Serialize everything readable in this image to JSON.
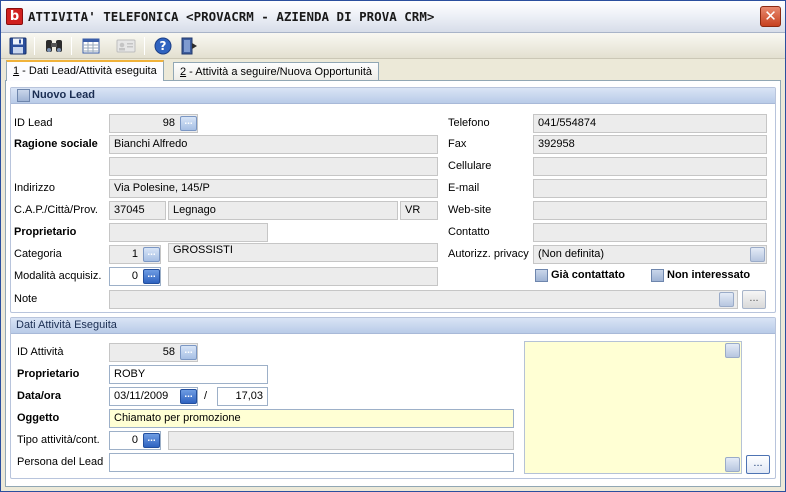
{
  "window": {
    "title": "ATTIVITA' TELEFONICA <PROVACRM - AZIENDA DI PROVA CRM>",
    "app_letter": "b",
    "close_glyph": "✕"
  },
  "toolbar": {
    "icons": [
      "save-icon",
      "binoculars-icon",
      "grid-icon",
      "contact-card-icon",
      "help-icon",
      "exit-door-icon"
    ]
  },
  "tabs": [
    {
      "num": "1",
      "label": " - Dati Lead/Attività eseguita",
      "active": true
    },
    {
      "num": "2",
      "label": " - Attività a seguire/Nuova Opportunità",
      "active": false
    }
  ],
  "lead": {
    "header": "Nuovo Lead",
    "id_label": "ID Lead",
    "id_value": "98",
    "ragione_label": "Ragione sociale",
    "ragione_value": "Bianchi Alfredo",
    "ragione_value2": "",
    "indirizzo_label": "Indirizzo",
    "indirizzo_value": "Via Polesine, 145/P",
    "cap_label": "C.A.P./Città/Prov.",
    "cap_value": "37045",
    "citta_value": "Legnago",
    "prov_value": "VR",
    "proprietario_label": "Proprietario",
    "proprietario_value": "",
    "categoria_label": "Categoria",
    "categoria_code": "1",
    "categoria_value": "GROSSISTI",
    "modalita_label": "Modalità acquisiz.",
    "modalita_code": "0",
    "modalita_value": "",
    "note_label": "Note",
    "note_value": "",
    "telefono_label": "Telefono",
    "telefono_value": "041/554874",
    "fax_label": "Fax",
    "fax_value": "392958",
    "cellulare_label": "Cellulare",
    "cellulare_value": "",
    "email_label": "E-mail",
    "email_value": "",
    "website_label": "Web-site",
    "website_value": "",
    "contatto_label": "Contatto",
    "contatto_value": "",
    "privacy_label": "Autorizz. privacy",
    "privacy_value": "(Non definita)",
    "gia_contattato_label": "Già contattato",
    "non_interessato_label": "Non interessato"
  },
  "attivita": {
    "header": "Dati Attività Eseguita",
    "id_label": "ID Attività",
    "id_value": "58",
    "proprietario_label": "Proprietario",
    "proprietario_value": "ROBY",
    "data_label": "Data/ora",
    "data_value": "03/11/2009",
    "ora_value": "17,03",
    "slash": "/",
    "oggetto_label": "Oggetto",
    "oggetto_value": "Chiamato per promozione",
    "tipo_label": "Tipo attività/cont.",
    "tipo_code": "0",
    "tipo_value": "",
    "persona_label": "Persona del Lead",
    "persona_value": "",
    "memo_value": ""
  },
  "buttons": {
    "dots": "...",
    "ellipsis": "..."
  },
  "colors": {
    "accent": "#2f63c0",
    "highlight_yellow": "#ffffd4",
    "tab_active_border": "#f0b23a"
  }
}
